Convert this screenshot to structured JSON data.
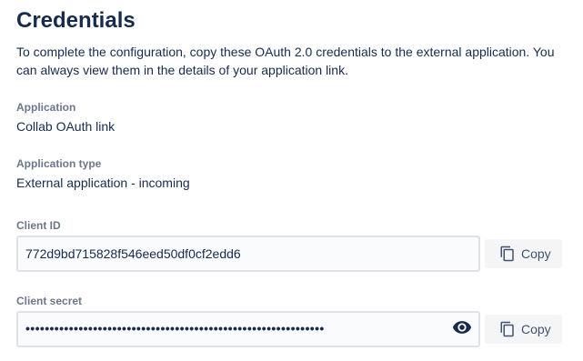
{
  "page": {
    "title": "Credentials",
    "description": "To complete the configuration, copy these OAuth 2.0 credentials to the external application. You can always view them in the details of your application link."
  },
  "application": {
    "label": "Application",
    "value": "Collab OAuth link"
  },
  "application_type": {
    "label": "Application type",
    "value": "External application - incoming"
  },
  "client_id": {
    "label": "Client ID",
    "value": "772d9bd715828f546eed50df0cf2edd6",
    "copy_label": "Copy"
  },
  "client_secret": {
    "label": "Client secret",
    "masked_value": "••••••••••••••••••••••••••••••••••••••••••••••••••••••••••••••",
    "copy_label": "Copy",
    "reveal_icon": "eye-icon"
  },
  "colors": {
    "text": "#172b4d",
    "label": "#6b778c",
    "input_bg": "#fafbfc",
    "input_border": "#dfe1e6",
    "button_bg": "#f4f5f7",
    "button_text": "#42526e"
  }
}
